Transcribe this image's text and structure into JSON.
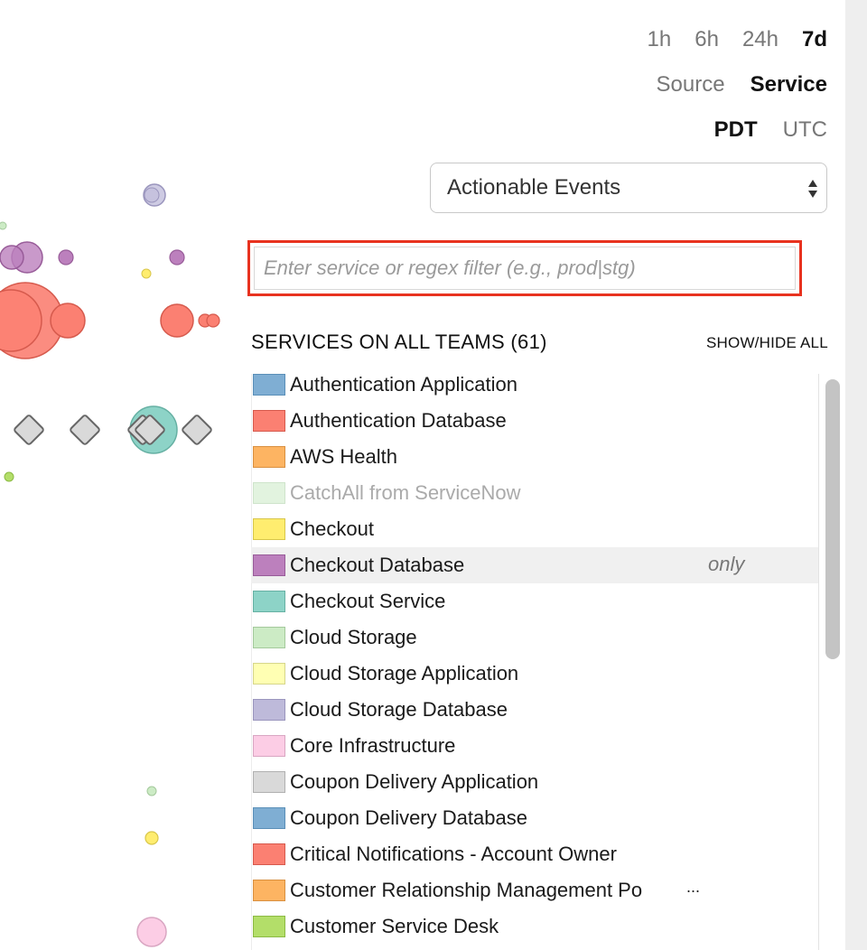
{
  "time_range": {
    "options": [
      "1h",
      "6h",
      "24h",
      "7d"
    ],
    "active": "7d"
  },
  "group_by": {
    "options": [
      "Source",
      "Service"
    ],
    "active": "Service"
  },
  "timezone": {
    "options": [
      "PDT",
      "UTC"
    ],
    "active": "PDT"
  },
  "event_filter": {
    "selected": "Actionable Events"
  },
  "search": {
    "placeholder": "Enter service or regex filter (e.g., prod|stg)",
    "value": ""
  },
  "service_list": {
    "title": "SERVICES ON ALL TEAMS (61)",
    "show_hide_label": "SHOW/HIDE ALL",
    "only_label": "only",
    "items": [
      {
        "label": "Authentication Application",
        "color": "#7faed3",
        "border": "#5a8fb8"
      },
      {
        "label": "Authentication Database",
        "color": "#fb8072",
        "border": "#d65a4d"
      },
      {
        "label": "AWS Health",
        "color": "#fdb462",
        "border": "#d99040"
      },
      {
        "label": "CatchAll from ServiceNow",
        "color": "#ccebc5",
        "border": "#a9cfa1",
        "muted": true
      },
      {
        "label": "Checkout",
        "color": "#ffed6f",
        "border": "#d8c64a"
      },
      {
        "label": "Checkout Database",
        "color": "#bc80bd",
        "border": "#985c99",
        "hover": true
      },
      {
        "label": "Checkout Service",
        "color": "#8dd3c7",
        "border": "#66b0a3"
      },
      {
        "label": "Cloud Storage",
        "color": "#ccebc5",
        "border": "#a4c99c"
      },
      {
        "label": "Cloud Storage Application",
        "color": "#ffffb3",
        "border": "#d6d68a"
      },
      {
        "label": "Cloud Storage Database",
        "color": "#bebada",
        "border": "#9a95bd"
      },
      {
        "label": "Core Infrastructure",
        "color": "#fccde5",
        "border": "#d9a6c2"
      },
      {
        "label": "Coupon Delivery Application",
        "color": "#d9d9d9",
        "border": "#b0b0b0"
      },
      {
        "label": "Coupon Delivery Database",
        "color": "#7faed3",
        "border": "#5a8fb8"
      },
      {
        "label": "Critical Notifications - Account Owner",
        "color": "#fb8072",
        "border": "#d65a4d"
      },
      {
        "label": "Customer Relationship Management Po",
        "color": "#fdb462",
        "border": "#d99040"
      },
      {
        "label": "Customer Service Desk",
        "color": "#b3de69",
        "border": "#8cba44"
      }
    ]
  },
  "colors": {
    "highlight_border": "#e8321f",
    "scrollbar": "#c4c4c4",
    "hover_row": "#f0f0f0"
  }
}
